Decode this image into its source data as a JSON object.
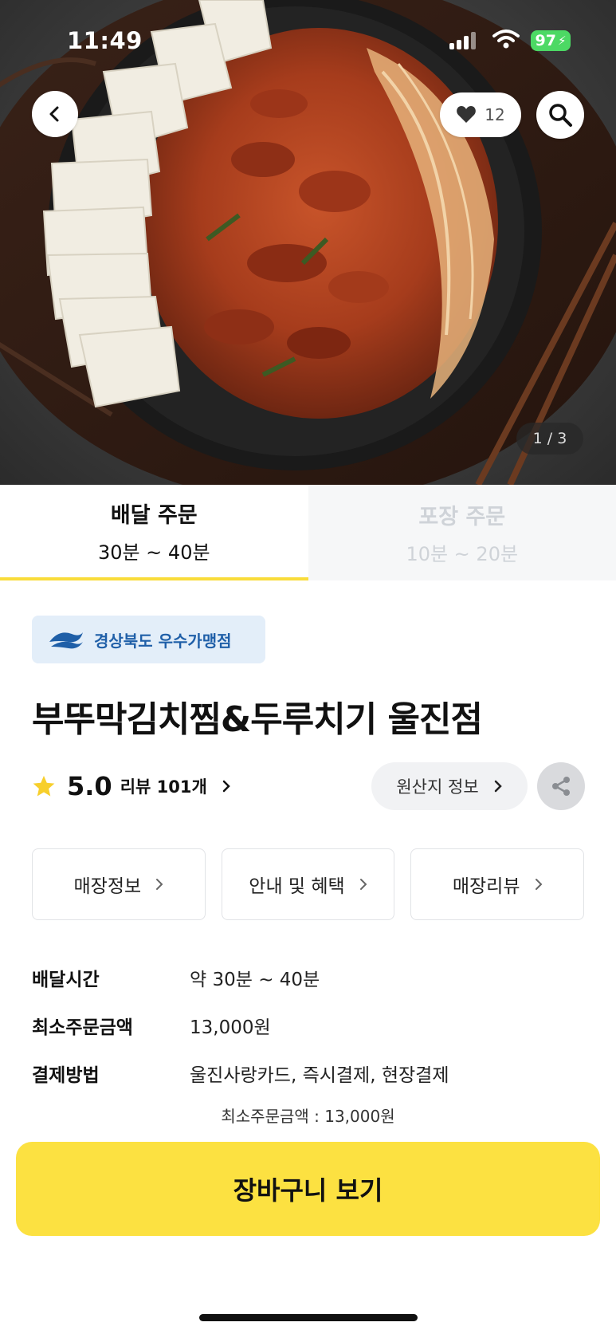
{
  "status_bar": {
    "time": "11:49",
    "battery": "97"
  },
  "hero": {
    "like_count": "12",
    "pager": "1 / 3"
  },
  "order_tabs": [
    {
      "title": "배달 주문",
      "time": "30분 ~ 40분",
      "active": true
    },
    {
      "title": "포장 주문",
      "time": "10분 ~ 20분",
      "active": false
    }
  ],
  "store": {
    "badge": "경상북도 우수가맹점",
    "name": "부뚜막김치찜&두루치기 울진점",
    "rating": "5.0",
    "review_label": "리뷰 101개",
    "origin_label": "원산지 정보"
  },
  "info_buttons": [
    {
      "label": "매장정보"
    },
    {
      "label": "안내 및 혜택"
    },
    {
      "label": "매장리뷰"
    }
  ],
  "details": [
    {
      "label": "배달시간",
      "value": "약 30분 ~ 40분"
    },
    {
      "label": "최소주문금액",
      "value": "13,000원"
    },
    {
      "label": "결제방법",
      "value": "울진사랑카드, 즉시결제, 현장결제"
    }
  ],
  "min_order_notice": "최소주문금액 : 13,000원",
  "cart_button": "장바구니 보기",
  "colors": {
    "accent_yellow": "#fce141",
    "tab_underline": "#f9dc3a",
    "badge_bg": "#e3eef9",
    "badge_text": "#1f5fa8"
  }
}
